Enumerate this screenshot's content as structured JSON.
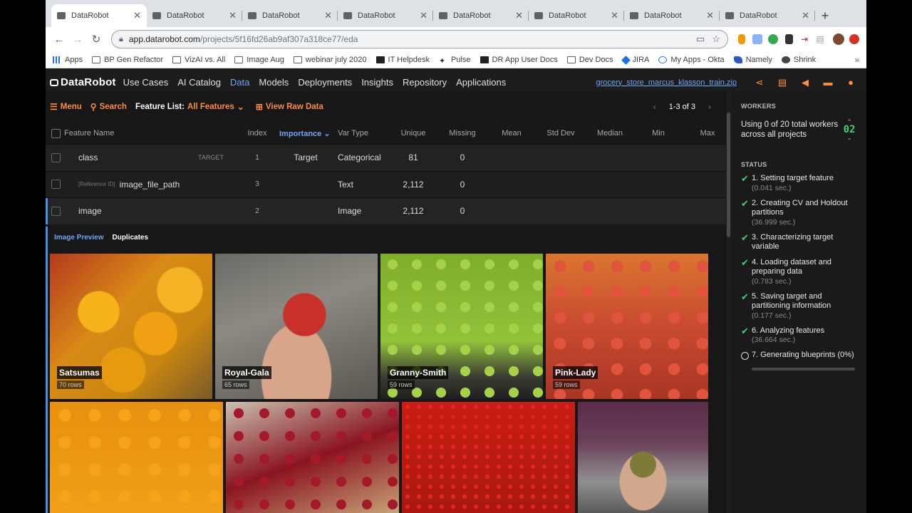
{
  "browser": {
    "tabs": [
      {
        "label": "DataRobot",
        "active": true
      },
      {
        "label": "DataRobot"
      },
      {
        "label": "DataRobot"
      },
      {
        "label": "DataRobot"
      },
      {
        "label": "DataRobot"
      },
      {
        "label": "DataRobot"
      },
      {
        "label": "DataRobot"
      },
      {
        "label": "DataRobot"
      }
    ],
    "url_host": "app.datarobot.com",
    "url_path": "/projects/5f16fd26ab9af307a318ce77/eda",
    "bookmarks": [
      {
        "label": "Apps",
        "icon": "grid"
      },
      {
        "label": "BP Gen Refactor",
        "icon": "folder"
      },
      {
        "label": "VizAI vs. All",
        "icon": "folder"
      },
      {
        "label": "Image Aug",
        "icon": "folder"
      },
      {
        "label": "webinar july 2020",
        "icon": "folder"
      },
      {
        "label": "IT Helpdesk",
        "icon": "fill"
      },
      {
        "label": "Pulse",
        "icon": "star"
      },
      {
        "label": "DR App User Docs",
        "icon": "folder"
      },
      {
        "label": "Dev Docs",
        "icon": "folder"
      },
      {
        "label": "JIRA",
        "icon": "blue"
      },
      {
        "label": "My Apps - Okta",
        "icon": "circle"
      },
      {
        "label": "Namely",
        "icon": "red"
      },
      {
        "label": "Shrink",
        "icon": "soccer"
      }
    ]
  },
  "app": {
    "logo": "DataRobot",
    "nav": [
      "Use Cases",
      "AI Catalog",
      "Data",
      "Models",
      "Deployments",
      "Insights",
      "Repository",
      "Applications"
    ],
    "active_nav": "Data",
    "project": "grocery_store_marcus_klasson_train.zip",
    "accent": "#ff8c3a",
    "link_blue": "#6fa5f5",
    "success_green": "#3dd17a"
  },
  "toolbar": {
    "menu": "Menu",
    "search": "Search",
    "feature_list_label": "Feature List:",
    "feature_list_value": "All Features",
    "view_raw": "View Raw Data",
    "pager": "1-3 of 3"
  },
  "table": {
    "columns": [
      "Feature Name",
      "Index",
      "Importance",
      "Var Type",
      "Unique",
      "Missing",
      "Mean",
      "Std Dev",
      "Median",
      "Min",
      "Max"
    ],
    "rows": [
      {
        "name": "class",
        "prefix": "",
        "tag": "TARGET",
        "index": "1",
        "importance": "Target",
        "vartype": "Categorical",
        "unique": "81",
        "missing": "0"
      },
      {
        "name": "image_file_path",
        "prefix": "[Reference ID]",
        "tag": "",
        "index": "3",
        "importance": "",
        "vartype": "Text",
        "unique": "2,112",
        "missing": "0"
      },
      {
        "name": "image",
        "prefix": "",
        "tag": "",
        "index": "2",
        "importance": "",
        "vartype": "Image",
        "unique": "2,112",
        "missing": "0"
      }
    ]
  },
  "preview": {
    "tabs": [
      "Image Preview",
      "Duplicates"
    ],
    "tiles": [
      {
        "name": "Satsumas",
        "rows": "70 rows"
      },
      {
        "name": "Royal-Gala",
        "rows": "65 rows"
      },
      {
        "name": "Granny-Smith",
        "rows": "59 rows"
      },
      {
        "name": "Pink-Lady",
        "rows": "59 rows"
      }
    ]
  },
  "workers": {
    "heading": "WORKERS",
    "text": "Using 0 of 20 total workers across all projects",
    "count": "02",
    "status_heading": "STATUS",
    "steps": [
      {
        "text": "1. Setting target feature",
        "time": "(0.041 sec.)"
      },
      {
        "text": "2. Creating CV and Holdout partitions",
        "time": "(36.999 sec.)"
      },
      {
        "text": "3. Characterizing target variable",
        "time": ""
      },
      {
        "text": "4. Loading dataset and preparing data",
        "time": "(0.783 sec.)"
      },
      {
        "text": "5. Saving target and partitioning information",
        "time": "(0.177 sec.)"
      },
      {
        "text": "6. Analyzing features",
        "time": "(36.664 sec.)"
      }
    ],
    "current_step": "7. Generating blueprints (0%)"
  }
}
